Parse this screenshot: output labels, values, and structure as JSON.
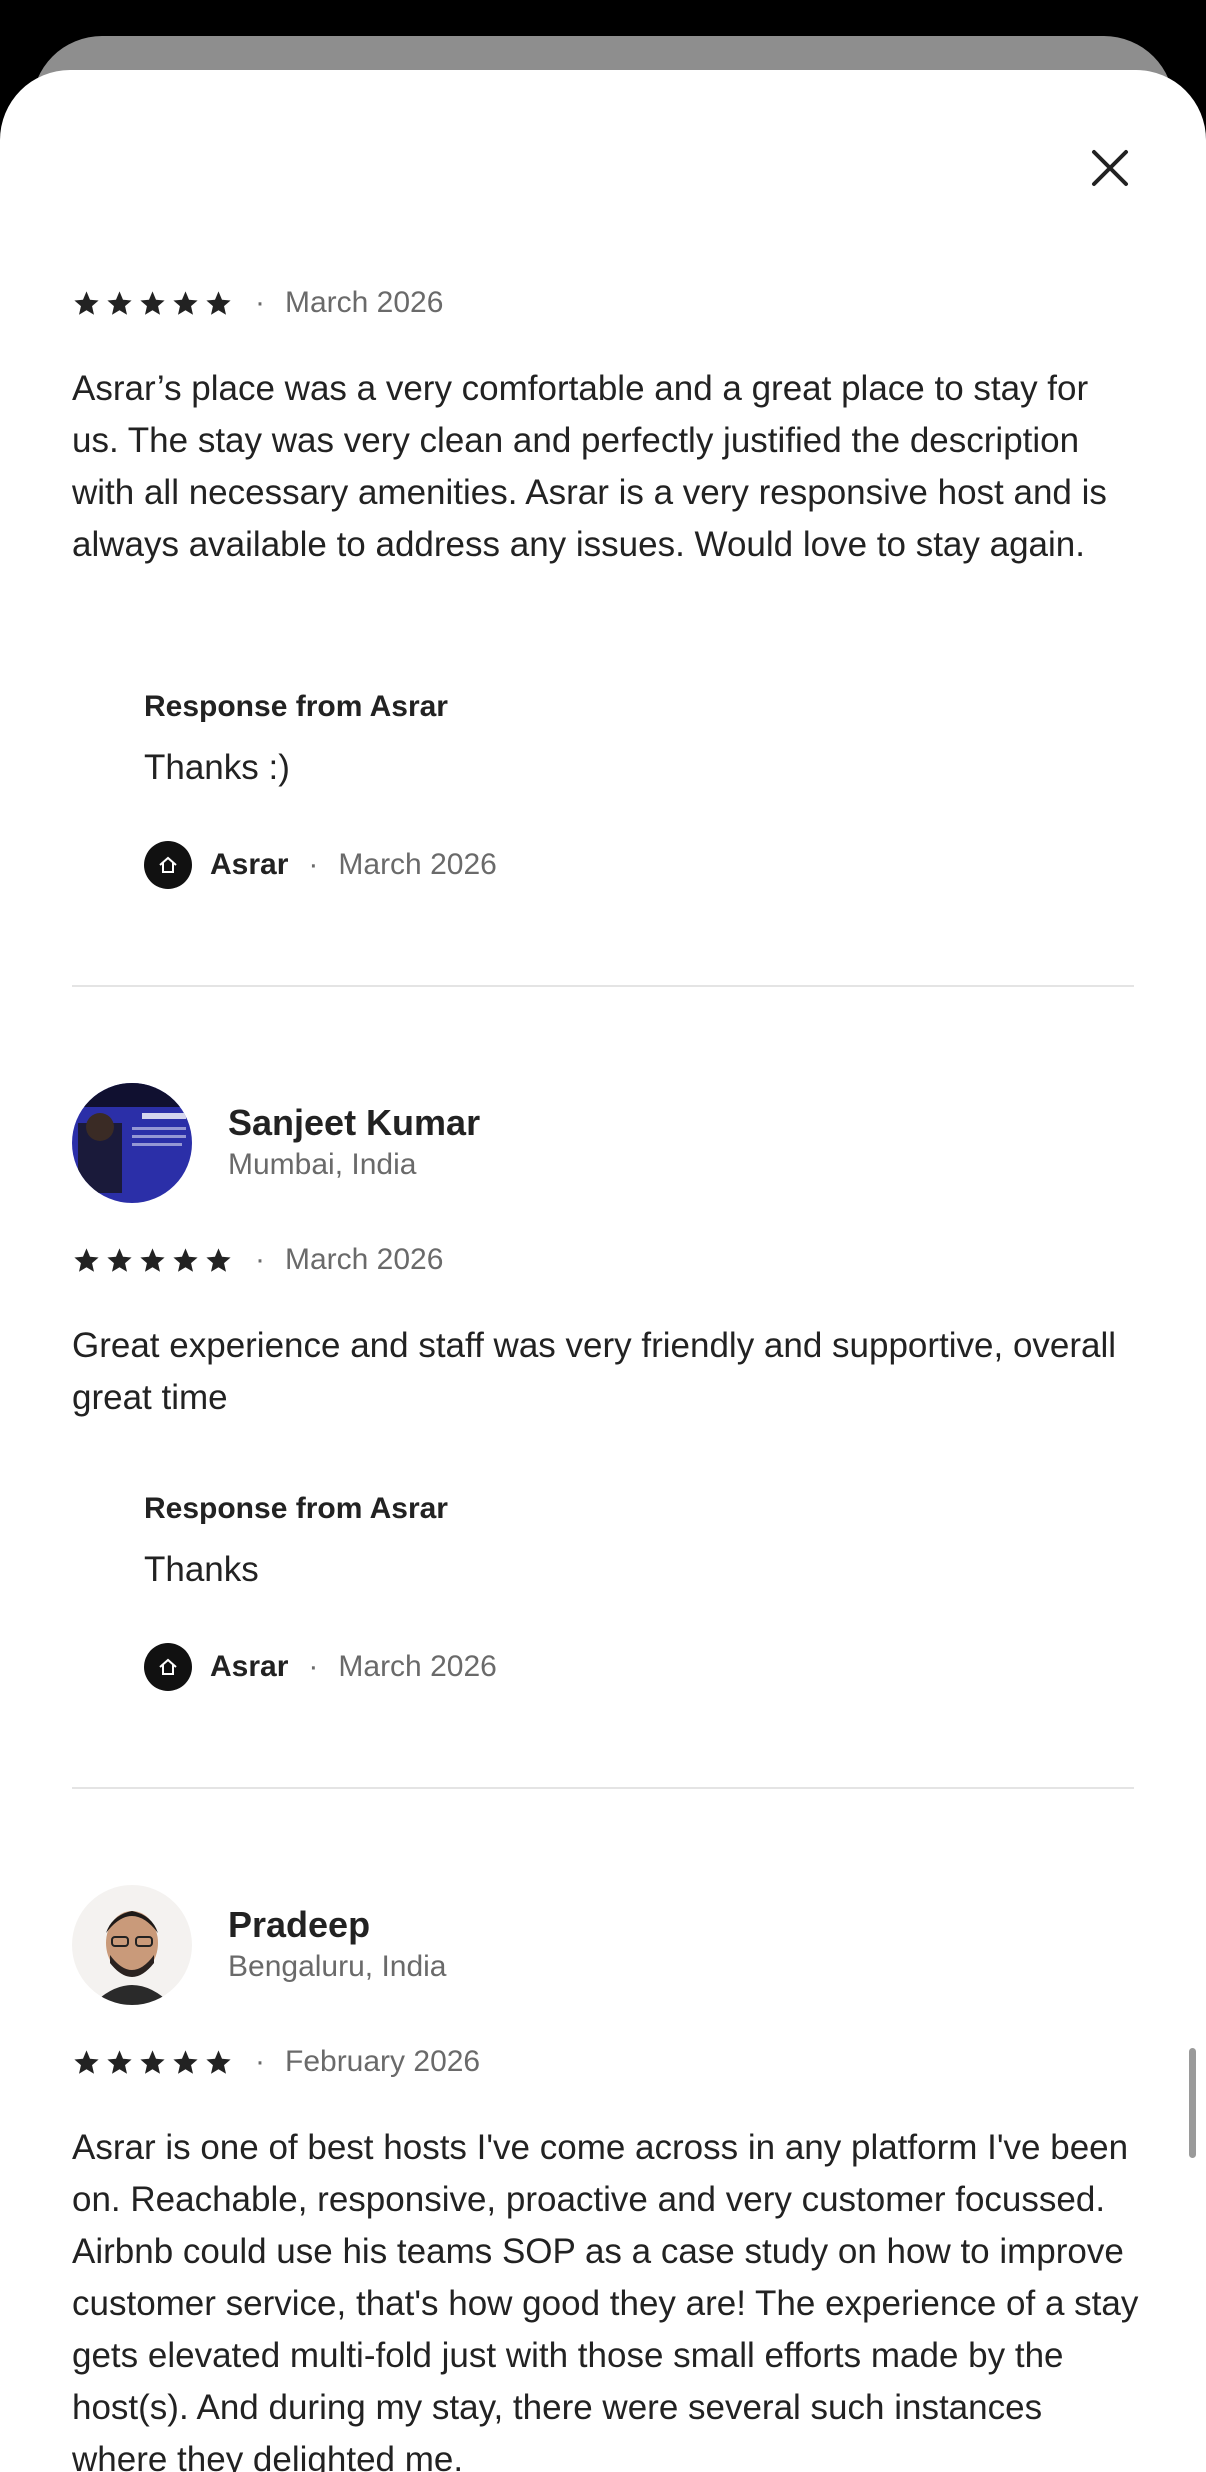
{
  "header": {
    "close_icon": "close-icon"
  },
  "colors": {
    "text": "#222222",
    "muted": "#6a6a6a",
    "star": "#222222",
    "divider": "#e4e4e4"
  },
  "reviews": [
    {
      "rating": 5,
      "date": "March 2026",
      "text": "Asrar’s place was a very comfortable and a great place to stay for us. The stay was very clean and perfectly justified the description with all necessary amenities. Asrar is a very responsive host and is always available to address any issues. Would love to stay again.",
      "response": {
        "label": "Response from Asrar",
        "text": "Thanks :)",
        "host_name": "Asrar",
        "date": "March 2026"
      }
    },
    {
      "name": "Sanjeet Kumar",
      "location": "Mumbai, India",
      "rating": 5,
      "date": "March 2026",
      "text": "Great experience and staff was very friendly and supportive, overall great time",
      "response": {
        "label": "Response from Asrar",
        "text": "Thanks",
        "host_name": "Asrar",
        "date": "March 2026"
      }
    },
    {
      "name": "Pradeep",
      "location": "Bengaluru, India",
      "rating": 5,
      "date": "February 2026",
      "text": "Asrar is one of best hosts I've come across in any platform I've been on. Reachable, responsive, proactive and very customer focussed. Airbnb could use his teams SOP as a case study on how to improve customer service, that's how good they are! The experience of a stay gets elevated multi-fold just with those small efforts made by the host(s). And during my stay, there were several such instances where they delighted me."
    }
  ],
  "separator": "·"
}
